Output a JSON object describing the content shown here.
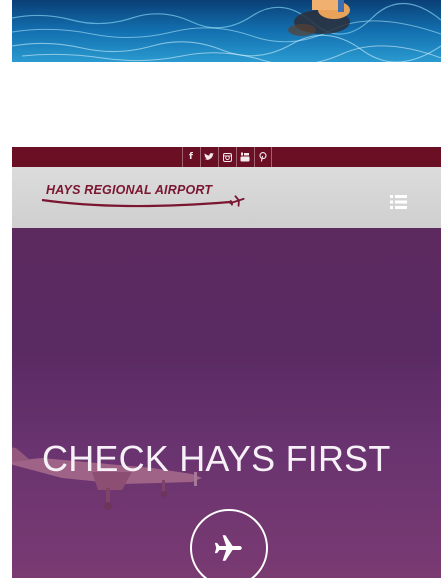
{
  "site": {
    "logo_text": "HAYS REGIONAL AIRPORT",
    "social_icons": [
      {
        "icon": "facebook-icon",
        "glyph": "f"
      },
      {
        "icon": "twitter-icon",
        "glyph": "t"
      },
      {
        "icon": "instagram-icon",
        "glyph": "◙"
      },
      {
        "icon": "youtube-icon",
        "glyph": "▶"
      },
      {
        "icon": "pinterest-icon",
        "glyph": "P"
      }
    ],
    "menu_icon": "hamburger-list-icon"
  },
  "hero": {
    "title": "CHECK HAYS FIRST",
    "button_icon": "airplane-icon"
  },
  "colors": {
    "social_bar": "#6a0f24",
    "header_bg": "#d4d4d4",
    "logo": "#7a1630",
    "hero_top": "#5c2a5e",
    "hero_bottom": "#7a3a72"
  }
}
